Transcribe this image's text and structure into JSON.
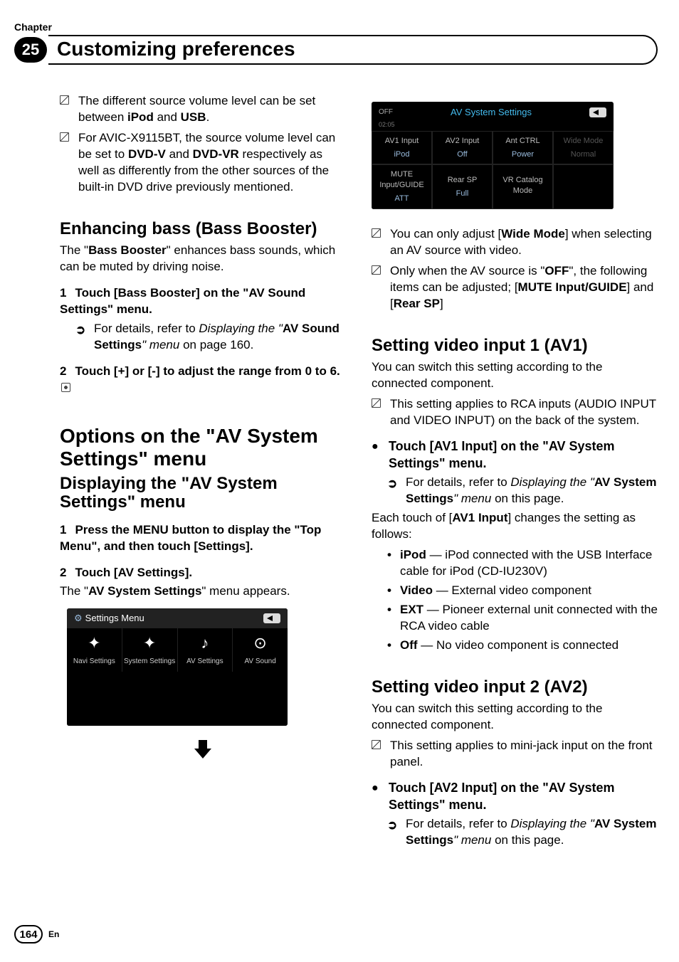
{
  "chapter_label": "Chapter",
  "chapter_number": "25",
  "chapter_title": "Customizing preferences",
  "left": {
    "note1": {
      "pre": "The different source volume level can be set between ",
      "b1": "iPod",
      "mid": " and ",
      "b2": "USB",
      "post": "."
    },
    "note2": {
      "pre": "For AVIC-X9115BT, the source volume level can be set to ",
      "b1": "DVD-V",
      "mid": " and ",
      "b2": "DVD-VR",
      "post": " respectively as well as differently from the other sources of the built-in DVD drive previously mentioned."
    },
    "sec1_h": {
      "bold": "Enhancing bass (",
      "light": "Bass Booster",
      "close": ")"
    },
    "sec1_p": {
      "pre": "The \"",
      "b": "Bass Booster",
      "post": "\" enhances bass sounds, which can be muted by driving noise."
    },
    "sec1_step1": {
      "num": "1",
      "text": "Touch [Bass Booster] on the \"AV Sound Settings\" menu."
    },
    "sec1_ref": {
      "pre": "For details, refer to ",
      "ital": "Displaying the \"",
      "b": "AV Sound Settings",
      "ital2": "\" menu",
      "post": " on page 160."
    },
    "sec1_step2": {
      "num": "2",
      "text": "Touch [+] or [-] to adjust the range from 0 to 6."
    },
    "sec2_h": {
      "bold1": "Options on the \"",
      "light": "AV System Settings",
      "bold2": "\" menu"
    },
    "sec2a_h": {
      "bold1": "Displaying the \"",
      "light": "AV System Settings",
      "bold2": "\" menu"
    },
    "sec2_step1": {
      "num": "1",
      "text": "Press the MENU button to display the \"Top Menu\", and then touch [Settings]."
    },
    "sec2_step2": {
      "num": "2",
      "text": "Touch [AV Settings]."
    },
    "sec2_p": {
      "pre": "The \"",
      "b": "AV System Settings",
      "post": "\" menu appears."
    }
  },
  "ss_settings": {
    "title": "Settings Menu",
    "items": [
      "Navi Settings",
      "System Settings",
      "AV Settings",
      "AV Sound"
    ]
  },
  "ss_av": {
    "title": "AV System Settings",
    "off": "OFF",
    "time": "02:05",
    "cells": [
      {
        "top": "AV1 Input",
        "bot": "iPod"
      },
      {
        "top": "AV2 Input",
        "bot": "Off"
      },
      {
        "top": "Ant CTRL",
        "bot": "Power"
      },
      {
        "top": "Wide Mode",
        "bot": "Normal",
        "dim": true
      },
      {
        "top": "MUTE Input/GUIDE",
        "bot": "ATT"
      },
      {
        "top": "Rear SP",
        "bot": "Full"
      },
      {
        "top": "VR Catalog Mode",
        "bot": ""
      },
      {
        "top": "",
        "bot": ""
      }
    ]
  },
  "right": {
    "note1": {
      "pre": "You can only adjust [",
      "b": "Wide Mode",
      "post": "] when selecting an AV source with video."
    },
    "note2": {
      "pre": "Only when the AV source is \"",
      "b1": "OFF",
      "mid": "\", the following items can be adjusted;\n[",
      "b2": "MUTE Input/GUIDE",
      "mid2": "] and [",
      "b3": "Rear SP",
      "post": "]"
    },
    "av1_h": {
      "bold": "Setting video input 1 (",
      "light": "AV1",
      "close": ")"
    },
    "av1_p": "You can switch this setting according to the connected component.",
    "av1_note": "This setting applies to RCA inputs (AUDIO INPUT and VIDEO INPUT) on the back of the system.",
    "av1_bullet": "Touch [AV1 Input] on the \"AV System Settings\" menu.",
    "av1_ref": {
      "pre": "For details, refer to ",
      "ital": "Displaying the \"",
      "b": "AV System Settings",
      "ital2": "\" menu",
      "post": " on this page."
    },
    "av1_each": {
      "pre": "Each touch of [",
      "b": "AV1 Input",
      "post": "] changes the setting as follows:"
    },
    "av1_opts": [
      {
        "b": "iPod",
        "post": " — iPod connected with the USB Interface cable for iPod (CD-IU230V)"
      },
      {
        "b": "Video",
        "post": " — External video component"
      },
      {
        "b": "EXT",
        "post": " — Pioneer external unit connected with the RCA video cable"
      },
      {
        "b": "Off",
        "post": " — No video component is connected"
      }
    ],
    "av2_h": {
      "bold": "Setting video input 2 (",
      "light": "AV2",
      "close": ")"
    },
    "av2_p": "You can switch this setting according to the connected component.",
    "av2_note": "This setting applies to mini-jack input on the front panel.",
    "av2_bullet": "Touch [AV2 Input] on the \"AV System Settings\" menu.",
    "av2_ref": {
      "pre": "For details, refer to ",
      "ital": "Displaying the \"",
      "b": "AV System Settings",
      "ital2": "\" menu",
      "post": " on this page."
    }
  },
  "page_number": "164",
  "page_lang": "En"
}
